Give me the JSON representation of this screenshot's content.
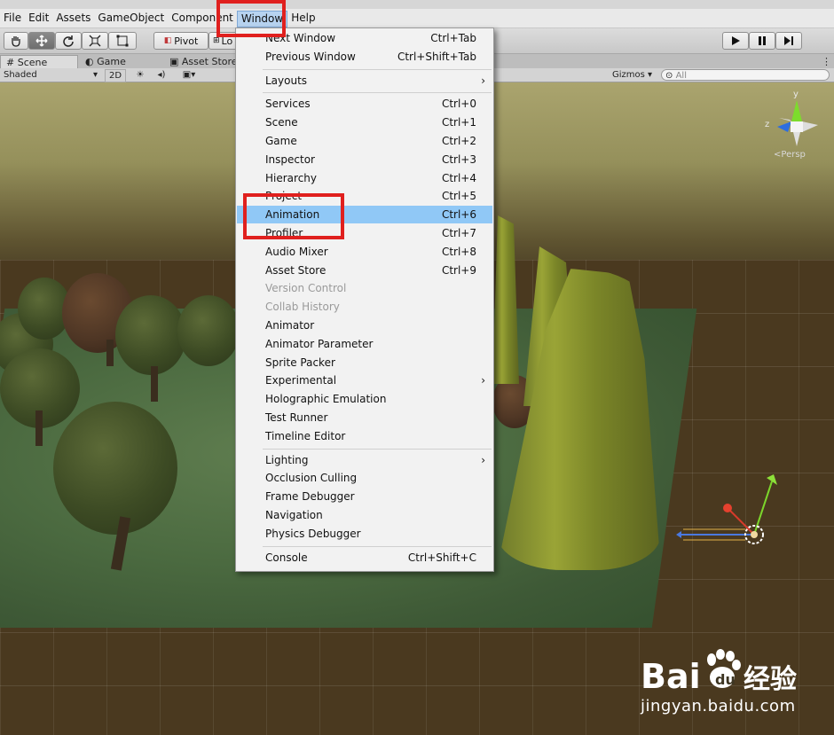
{
  "menubar": {
    "items": [
      {
        "label": "File"
      },
      {
        "label": "Edit"
      },
      {
        "label": "Assets"
      },
      {
        "label": "GameObject"
      },
      {
        "label": "Component"
      },
      {
        "label": "Window"
      },
      {
        "label": "Help"
      }
    ]
  },
  "toolbar": {
    "pivot_label": "Pivot",
    "local_label": "Lo",
    "tools": [
      "hand-icon",
      "move-icon",
      "rotate-icon",
      "scale-icon",
      "rect-icon"
    ],
    "playback": [
      "play-icon",
      "pause-icon",
      "step-icon"
    ]
  },
  "tabs": {
    "scene": "Scene",
    "game": "Game",
    "asset_store": "Asset Store"
  },
  "scenebar": {
    "shading_mode": "Shaded",
    "mode_2d": "2D",
    "gizmos": "Gizmos",
    "search_placeholder": "All"
  },
  "gizmo": {
    "y_label": "y",
    "z_label": "z",
    "persp_label": "Persp"
  },
  "window_menu": {
    "groups": [
      [
        {
          "label": "Next Window",
          "shortcut": "Ctrl+Tab"
        },
        {
          "label": "Previous Window",
          "shortcut": "Ctrl+Shift+Tab"
        }
      ],
      [
        {
          "label": "Layouts",
          "submenu": true
        }
      ],
      [
        {
          "label": "Services",
          "shortcut": "Ctrl+0"
        },
        {
          "label": "Scene",
          "shortcut": "Ctrl+1"
        },
        {
          "label": "Game",
          "shortcut": "Ctrl+2"
        },
        {
          "label": "Inspector",
          "shortcut": "Ctrl+3"
        },
        {
          "label": "Hierarchy",
          "shortcut": "Ctrl+4"
        },
        {
          "label": "Project",
          "shortcut": "Ctrl+5"
        },
        {
          "label": "Animation",
          "shortcut": "Ctrl+6",
          "highlighted": true
        },
        {
          "label": "Profiler",
          "shortcut": "Ctrl+7"
        },
        {
          "label": "Audio Mixer",
          "shortcut": "Ctrl+8"
        },
        {
          "label": "Asset Store",
          "shortcut": "Ctrl+9"
        },
        {
          "label": "Version Control",
          "disabled": true
        },
        {
          "label": "Collab History",
          "disabled": true
        },
        {
          "label": "Animator"
        },
        {
          "label": "Animator Parameter"
        },
        {
          "label": "Sprite Packer"
        },
        {
          "label": "Experimental",
          "submenu": true
        },
        {
          "label": "Holographic Emulation"
        },
        {
          "label": "Test Runner"
        },
        {
          "label": "Timeline Editor"
        }
      ],
      [
        {
          "label": "Lighting",
          "submenu": true
        },
        {
          "label": "Occlusion Culling"
        },
        {
          "label": "Frame Debugger"
        },
        {
          "label": "Navigation"
        },
        {
          "label": "Physics Debugger"
        }
      ],
      [
        {
          "label": "Console",
          "shortcut": "Ctrl+Shift+C"
        }
      ]
    ]
  },
  "watermark": {
    "brand": "Bai",
    "brand_cn": "经验",
    "url": "jingyan.baidu.com"
  }
}
